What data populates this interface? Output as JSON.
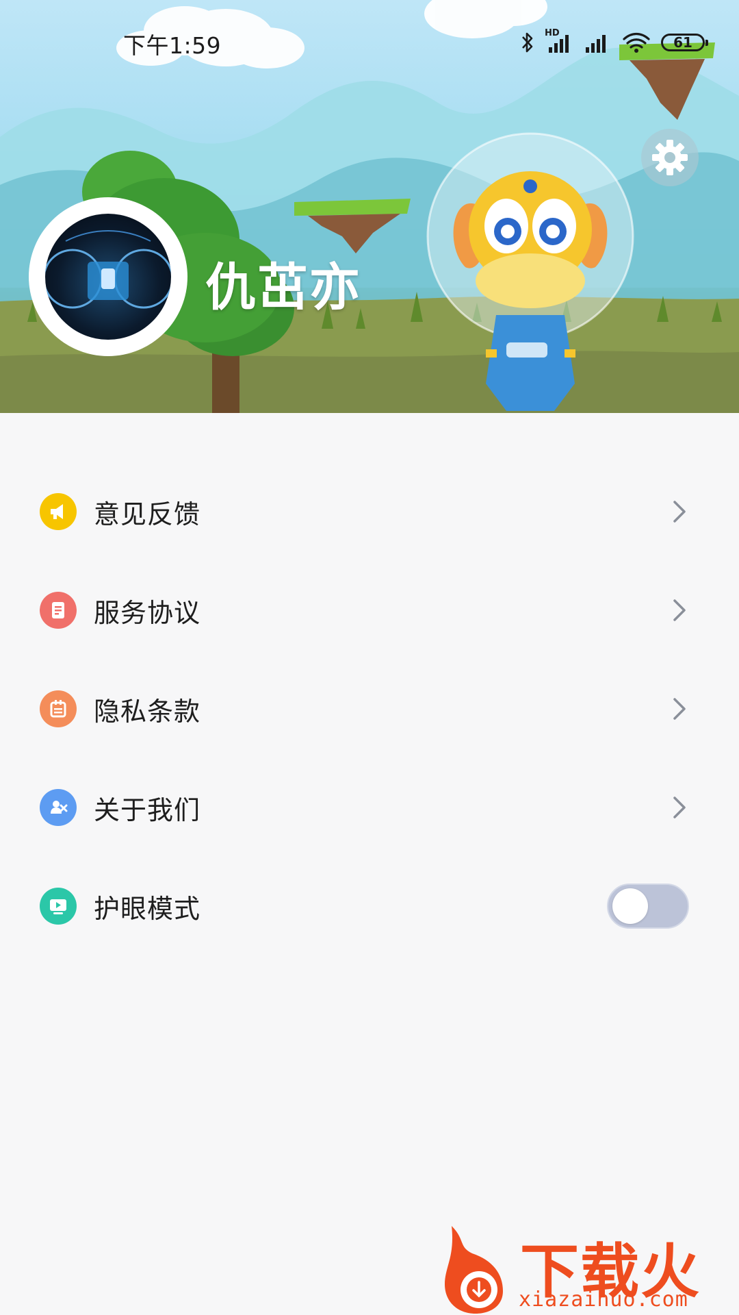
{
  "status_bar": {
    "time": "下午1:59",
    "network_label": "HD",
    "battery": "61"
  },
  "profile": {
    "user_name": "仇茁亦"
  },
  "menu": {
    "items": [
      {
        "label": "意见反馈",
        "icon": "megaphone-icon",
        "color": "#f7c500"
      },
      {
        "label": "服务协议",
        "icon": "document-icon",
        "color": "#f0706a"
      },
      {
        "label": "隐私条款",
        "icon": "calendar-icon",
        "color": "#f48d5a"
      },
      {
        "label": "关于我们",
        "icon": "puzzle-icon",
        "color": "#5d9cf2"
      },
      {
        "label": "护眼模式",
        "icon": "screen-icon",
        "color": "#2bc7a8"
      }
    ],
    "eye_protection_enabled": false
  },
  "watermark": {
    "brand": "下载火",
    "site": "xiazaihuo.com",
    "color": "#ee4d1f"
  }
}
